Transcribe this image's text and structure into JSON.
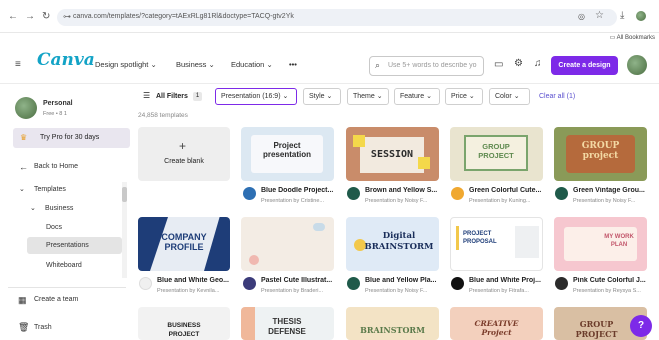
{
  "browser": {
    "url": "canva.com/templates/?category=tAExRLg81Rl&doctype=TACQ-gtv2Yk",
    "bookmarks": "All Bookmarks"
  },
  "header": {
    "logo": "Canva",
    "nav": [
      "Design spotlight",
      "Business",
      "Education"
    ],
    "more": "•••",
    "search_placeholder": "Use 5+ words to describe yo",
    "cta": "Create a design"
  },
  "sidebar": {
    "account": "Personal",
    "plan": "Free • 8 1",
    "pro": "Try Pro for 30 days",
    "back": "Back to Home",
    "templates": "Templates",
    "business": "Business",
    "items": [
      "Docs",
      "Presentations",
      "Whiteboard"
    ],
    "team": "Create a team",
    "trash": "Trash"
  },
  "filters": {
    "all": "All Filters",
    "all_count": "1",
    "chips": [
      "Presentation (16:9)",
      "Style",
      "Theme",
      "Feature",
      "Price",
      "Color"
    ],
    "clear": "Clear all (1)",
    "count": "24,858 templates"
  },
  "create_blank": "Create blank",
  "cards": [
    {
      "title": "Blue Doodle Project...",
      "sub": "Presentation by Cristine...",
      "thumb": "Project presentation"
    },
    {
      "title": "Brown and Yellow S...",
      "sub": "Presentation by Noisy F...",
      "thumb": "SESSION"
    },
    {
      "title": "Green Colorful Cute...",
      "sub": "Presentation by Kuning...",
      "thumb": "GROUP PROJECT"
    },
    {
      "title": "Green Vintage Grou...",
      "sub": "Presentation by Noisy F...",
      "thumb": "GROUP project"
    },
    {
      "title": "Blue and White Geo...",
      "sub": "Presentation by Kevnila...",
      "thumb": "COMPANY PROFILE"
    },
    {
      "title": "Pastel Cute Illustrat...",
      "sub": "Presentation by Braderi...",
      "thumb": ""
    },
    {
      "title": "Blue and Yellow Pla...",
      "sub": "Presentation by Noisy F...",
      "thumb": "Digital BRAINSTORM"
    },
    {
      "title": "Blue and White Proj...",
      "sub": "Presentation by Fitrafa...",
      "thumb": "PROJECT PROPOSAL"
    },
    {
      "title": "Pink Cute Colorful J...",
      "sub": "Presentation by Reysya S...",
      "thumb": "MY WORK PLAN"
    }
  ],
  "row3": [
    "BUSINESS PROJECT",
    "THESIS DEFENSE",
    "BRAINSTORM",
    "CREATIVE Project",
    "GROUP PROJECT"
  ],
  "help": "?"
}
